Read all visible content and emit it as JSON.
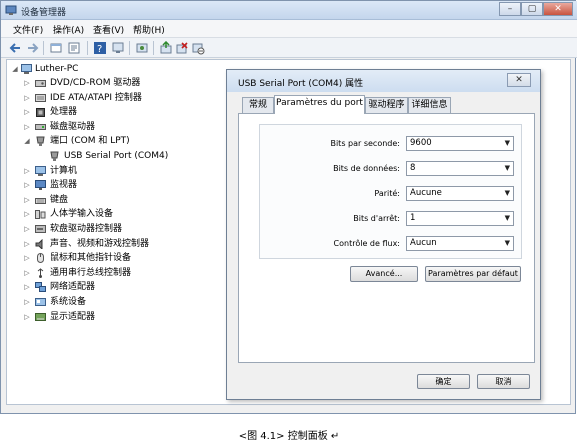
{
  "window": {
    "title": "设备管理器"
  },
  "menu": [
    "文件(F)",
    "操作(A)",
    "查看(V)",
    "帮助(H)"
  ],
  "toolbar_icons": [
    "back-icon",
    "forward-icon",
    "view-icon",
    "properties-icon",
    "help-icon",
    "device-icon",
    "scan-icon",
    "update-driver-icon",
    "uninstall-icon",
    "disable-icon"
  ],
  "tree": {
    "root": "Luther-PC",
    "items": [
      {
        "label": "DVD/CD-ROM 驱动器",
        "icon": "dvd-drive-icon",
        "level": 1
      },
      {
        "label": "IDE ATA/ATAPI 控制器",
        "icon": "ide-controller-icon",
        "level": 1
      },
      {
        "label": "处理器",
        "icon": "processor-icon",
        "level": 1
      },
      {
        "label": "磁盘驱动器",
        "icon": "disk-drive-icon",
        "level": 1
      },
      {
        "label": "端口 (COM 和 LPT)",
        "icon": "port-icon",
        "level": 1,
        "expanded": true
      },
      {
        "label": "USB Serial Port (COM4)",
        "icon": "usb-port-icon",
        "level": 2
      },
      {
        "label": "计算机",
        "icon": "computer-icon",
        "level": 1
      },
      {
        "label": "监视器",
        "icon": "monitor-icon",
        "level": 1
      },
      {
        "label": "键盘",
        "icon": "keyboard-icon",
        "level": 1
      },
      {
        "label": "人体学输入设备",
        "icon": "hid-icon",
        "level": 1
      },
      {
        "label": "软盘驱动器控制器",
        "icon": "floppy-controller-icon",
        "level": 1
      },
      {
        "label": "声音、视频和游戏控制器",
        "icon": "sound-icon",
        "level": 1
      },
      {
        "label": "鼠标和其他指针设备",
        "icon": "mouse-icon",
        "level": 1
      },
      {
        "label": "通用串行总线控制器",
        "icon": "usb-controller-icon",
        "level": 1
      },
      {
        "label": "网络适配器",
        "icon": "network-adapter-icon",
        "level": 1
      },
      {
        "label": "系统设备",
        "icon": "system-device-icon",
        "level": 1
      },
      {
        "label": "显示适配器",
        "icon": "display-adapter-icon",
        "level": 1
      }
    ]
  },
  "dialog": {
    "title": "USB Serial Port (COM4) 属性",
    "tabs": [
      "常规",
      "Paramètres du port",
      "驱动程序",
      "详细信息"
    ],
    "active_tab": 1,
    "fields": [
      {
        "label": "Bits par seconde:",
        "value": "9600"
      },
      {
        "label": "Bits de données:",
        "value": "8"
      },
      {
        "label": "Parité:",
        "value": "Aucune"
      },
      {
        "label": "Bits d'arrêt:",
        "value": "1"
      },
      {
        "label": "Contrôle de flux:",
        "value": "Aucun"
      }
    ],
    "advanced_button": "Avancé...",
    "defaults_button": "Paramètres par défaut",
    "ok_button": "确定",
    "cancel_button": "取消"
  },
  "caption": "<图 4.1> 控制面板 ↵",
  "colors": {
    "titlebar": "#c4d6ec",
    "tree_bg": "#ffffff",
    "dialog_bg": "#f0f0f0"
  }
}
